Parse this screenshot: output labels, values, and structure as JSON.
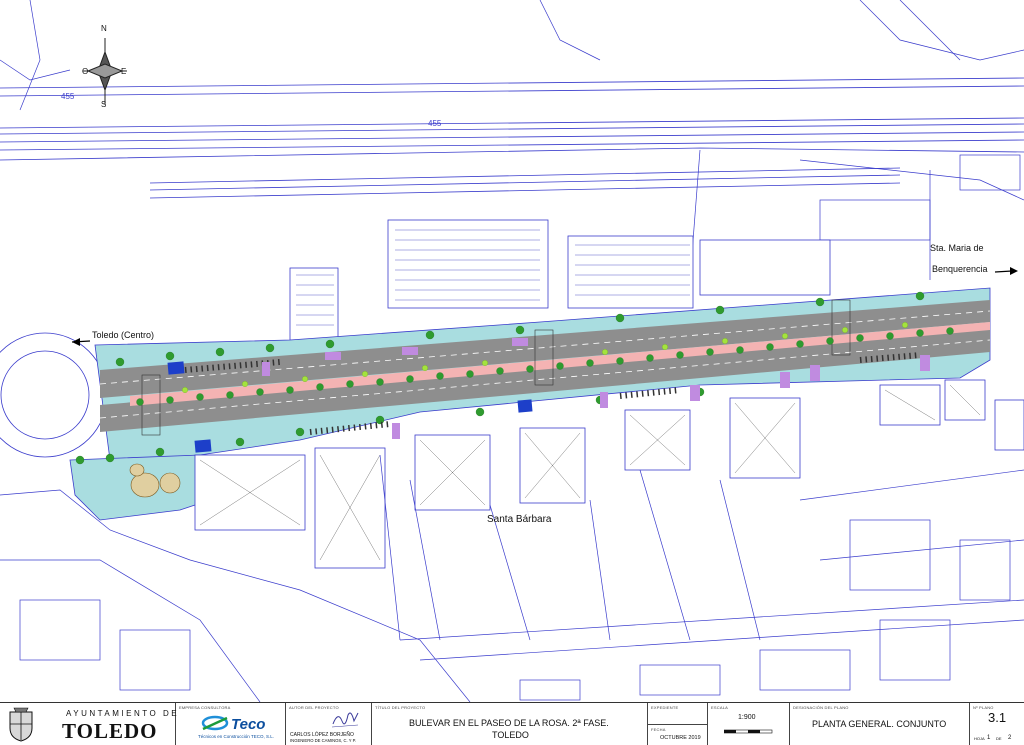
{
  "map": {
    "compass": {
      "north": "N",
      "south": "S",
      "east": "E",
      "west": "O"
    },
    "road_numbers": [
      "455",
      "455"
    ],
    "place_labels": {
      "toledo_centro": "Toledo (Centro)",
      "santa_maria_line1": "Sta. Maria de",
      "santa_maria_line2": "Benquerencia",
      "santa_barbara": "Santa Bárbara"
    },
    "colors": {
      "asphalt": "#8e8e8e",
      "boulevard_paving": "#f4b3b3",
      "sidewalk": "#a9dde0",
      "trees": "#2f9b2f",
      "young_trees": "#a4e33d",
      "linework": "#3a3ccc",
      "parking_accessible": "#1d3fc9",
      "purple_pavement": "#c08be0"
    }
  },
  "title_block": {
    "municipality_top": "AYUNTAMIENTO DE",
    "municipality_name": "TOLEDO",
    "company_caption": "EMPRESA CONSULTORA",
    "company_logo": "Teco",
    "company_name": "Técnicos en Construcción TECO, S.L.",
    "author_caption": "AUTOR DEL PROYECTO",
    "author_name": "CARLOS LÓPEZ BORJEÑO",
    "author_title": "INGENIERO DE CAMINOS, C. Y P.",
    "project_caption": "TÍTULO DEL PROYECTO",
    "project_title_line1": "BULEVAR EN EL PASEO DE LA ROSA. 2ª FASE.",
    "project_title_line2": "TOLEDO",
    "file_caption": "EXPEDIENTE",
    "date_caption": "FECHA",
    "date": "OCTUBRE 2019",
    "scale_caption": "ESCALA",
    "scale": "1:900",
    "plan_caption": "DESIGNACIÓN DEL PLANO",
    "plan_name": "PLANTA GENERAL. CONJUNTO",
    "plan_no_caption": "Nº PLANO",
    "plan_no": "3.1",
    "sheet_caption": "HOJA",
    "sheet_num": "1",
    "sheet_of": "DE",
    "sheet_total": "2"
  }
}
